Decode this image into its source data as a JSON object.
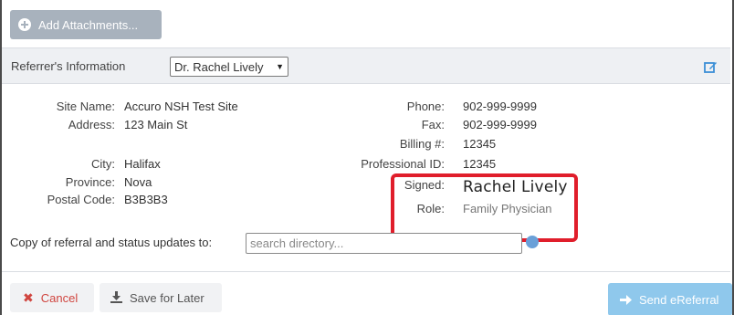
{
  "toolbar": {
    "add_attachments_label": "Add Attachments...",
    "add_attachments_icon": "plus-circle-icon"
  },
  "referrer": {
    "header_label": "Referrer's Information",
    "selected_referrer": "Dr. Rachel Lively",
    "edit_icon": "edit-icon"
  },
  "details_left": {
    "site_name_label": "Site Name:",
    "site_name_value": "Accuro NSH Test Site",
    "address_label": "Address:",
    "address_value": "123 Main St",
    "city_label": "City:",
    "city_value": "Halifax",
    "province_label": "Province:",
    "province_value": "Nova",
    "postal_code_label": "Postal Code:",
    "postal_code_value": "B3B3B3"
  },
  "details_right": {
    "phone_label": "Phone:",
    "phone_value": "902-999-9999",
    "fax_label": "Fax:",
    "fax_value": "902-999-9999",
    "billing_label": "Billing #:",
    "billing_value": "12345",
    "professional_id_label": "Professional ID:",
    "professional_id_value": "12345",
    "signed_label": "Signed:",
    "signed_value": "Rachel Lively",
    "role_label": "Role:",
    "role_value": "Family Physician"
  },
  "copy_to": {
    "label": "Copy of referral and status updates to:",
    "placeholder": "search directory..."
  },
  "footer": {
    "cancel_label": "Cancel",
    "save_label": "Save for Later",
    "send_label": "Send eReferral"
  },
  "colors": {
    "highlight": "#e01e2b",
    "send_button": "#8fc8ec",
    "cancel_text": "#d0453f",
    "attach_button": "#a8b2bd"
  }
}
